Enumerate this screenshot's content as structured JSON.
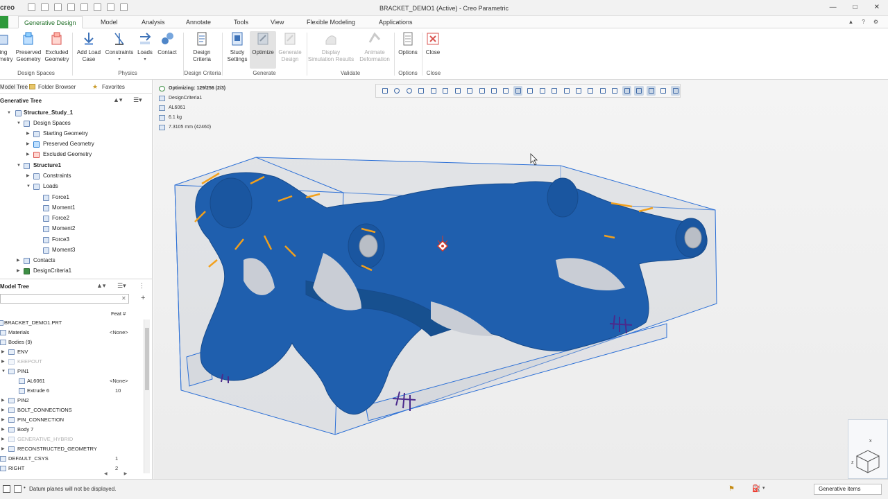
{
  "window": {
    "app_logo": "creo",
    "title": "BRACKET_DEMO1 (Active) - Creo Parametric"
  },
  "ribbon_tabs": [
    "Generative Design",
    "Model",
    "Analysis",
    "Annotate",
    "Tools",
    "View",
    "Flexible Modeling",
    "Applications"
  ],
  "ribbon": {
    "buttons": [
      {
        "label": "ing\nometry",
        "group": "Design Spaces"
      },
      {
        "label": "Preserved\nGeometry",
        "group": "Design Spaces"
      },
      {
        "label": "Excluded\nGeometry",
        "group": "Design Spaces"
      },
      {
        "label": "Add Load\nCase",
        "group": "Physics"
      },
      {
        "label": "Constraints",
        "group": "Physics"
      },
      {
        "label": "Loads",
        "group": "Physics"
      },
      {
        "label": "Contact",
        "group": "Physics"
      },
      {
        "label": "Design\nCriteria",
        "group": "Design Criteria"
      },
      {
        "label": "Study\nSettings",
        "group": "Generate"
      },
      {
        "label": "Optimize",
        "group": "Generate"
      },
      {
        "label": "Generate\nDesign",
        "group": "Generate"
      },
      {
        "label": "Display\nSimulation Results",
        "group": "Validate"
      },
      {
        "label": "Animate\nDeformation",
        "group": "Validate"
      },
      {
        "label": "Options",
        "group": "Options"
      },
      {
        "label": "Close",
        "group": "Close"
      }
    ],
    "groups": [
      "Design Spaces",
      "Physics",
      "Design Criteria",
      "Generate",
      "Validate",
      "Options",
      "Close"
    ]
  },
  "left_panel": {
    "tabs": [
      "Model Tree",
      "Folder Browser",
      "Favorites"
    ],
    "generative_tree": {
      "heading": "Generative Tree",
      "items": [
        {
          "label": "Structure_Study_1"
        },
        {
          "label": "Design Spaces"
        },
        {
          "label": "Starting Geometry"
        },
        {
          "label": "Preserved Geometry"
        },
        {
          "label": "Excluded Geometry"
        },
        {
          "label": "Structure1"
        },
        {
          "label": "Constraints"
        },
        {
          "label": "Loads"
        },
        {
          "label": "Force1"
        },
        {
          "label": "Moment1"
        },
        {
          "label": "Force2"
        },
        {
          "label": "Moment2"
        },
        {
          "label": "Force3"
        },
        {
          "label": "Moment3"
        },
        {
          "label": "Contacts"
        },
        {
          "label": "DesignCriteria1"
        }
      ]
    },
    "model_tree": {
      "heading": "Model Tree",
      "column_header": "Feat #",
      "rows": [
        {
          "label": "BRACKET_DEMO1.PRT",
          "value": ""
        },
        {
          "label": "Materials",
          "value": "<None>"
        },
        {
          "label": "Bodies (9)",
          "value": ""
        },
        {
          "label": "ENV",
          "value": ""
        },
        {
          "label": "KEEPOUT",
          "value": ""
        },
        {
          "label": "PIN1",
          "value": ""
        },
        {
          "label": "AL6061",
          "value": "<None>"
        },
        {
          "label": "Extrude 6",
          "value": "10"
        },
        {
          "label": "PIN2",
          "value": ""
        },
        {
          "label": "BOLT_CONNECTIONS",
          "value": ""
        },
        {
          "label": "PIN_CONNECTION",
          "value": ""
        },
        {
          "label": "Body 7",
          "value": ""
        },
        {
          "label": "GENERATIVE_HYBRID",
          "value": ""
        },
        {
          "label": "RECONSTRUCTED_GEOMETRY",
          "value": ""
        },
        {
          "label": "DEFAULT_CSYS",
          "value": "1"
        },
        {
          "label": "RIGHT",
          "value": "2"
        }
      ]
    }
  },
  "viewport": {
    "status": {
      "optimizing": "Optimizing: 129/256 (2/3)",
      "criteria": "DesignCriteria1",
      "material": "AL6061",
      "mass": "6.1 kg",
      "resolution": "7.3105 mm (42460)"
    }
  },
  "statusbar": {
    "message": "Datum planes will not be displayed.",
    "filter": "Generative items"
  },
  "colors": {
    "accent_green": "#2e9a3b",
    "part_blue": "#1f5fae",
    "box_blue": "#2b6fd6",
    "load_orange": "#f2a01c",
    "constraint_purple": "#4b2a8c"
  }
}
